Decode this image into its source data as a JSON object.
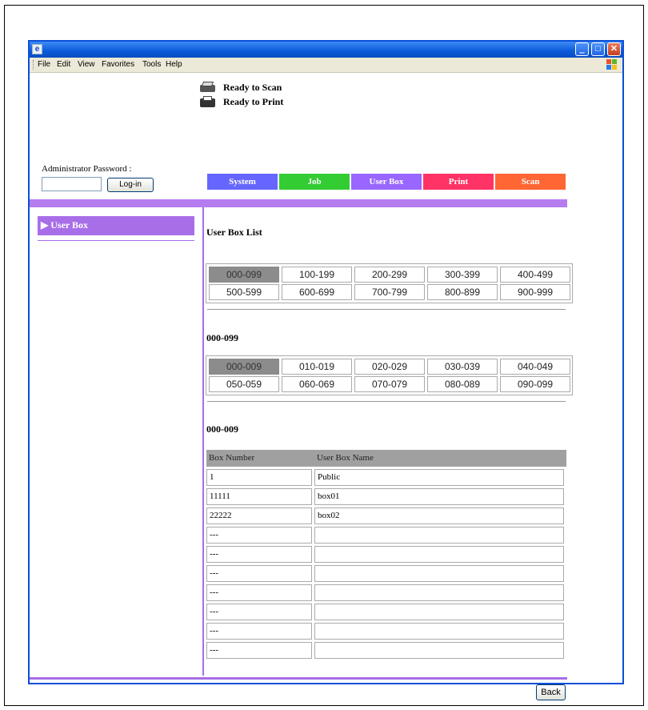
{
  "menu": [
    "File",
    "Edit",
    "View",
    "Favorites",
    "Tools",
    "Help"
  ],
  "titlebar": {
    "min": "‗",
    "max": "□",
    "close": "✕"
  },
  "status": {
    "scan": "Ready to Scan",
    "print": "Ready to Print"
  },
  "admin": {
    "label": "Administrator Password :",
    "password_value": "",
    "login_label": "Log-in"
  },
  "tabs": [
    {
      "label": "System",
      "color": "#6666ff"
    },
    {
      "label": "Job",
      "color": "#33cc33"
    },
    {
      "label": "User Box",
      "color": "#9966ff"
    },
    {
      "label": "Print",
      "color": "#ff3366"
    },
    {
      "label": "Scan",
      "color": "#ff6633"
    }
  ],
  "sidebar": {
    "item": "▶ User Box"
  },
  "list_title": "User Box List",
  "ranges": [
    [
      "000-099",
      "100-199",
      "200-299",
      "300-399",
      "400-499"
    ],
    [
      "500-599",
      "600-699",
      "700-799",
      "800-899",
      "900-999"
    ]
  ],
  "sub_title": "000-099",
  "subranges": [
    [
      "000-009",
      "010-019",
      "020-029",
      "030-039",
      "040-049"
    ],
    [
      "050-059",
      "060-069",
      "070-079",
      "080-089",
      "090-099"
    ]
  ],
  "box_title": "000-009",
  "box_table": {
    "headers": [
      "Box Number",
      "User Box Name"
    ],
    "rows": [
      [
        "1",
        "Public"
      ],
      [
        "11111",
        "box01"
      ],
      [
        "22222",
        "box02"
      ],
      [
        "---",
        ""
      ],
      [
        "---",
        ""
      ],
      [
        "---",
        ""
      ],
      [
        "---",
        ""
      ],
      [
        "---",
        ""
      ],
      [
        "---",
        ""
      ],
      [
        "---",
        ""
      ]
    ]
  },
  "back_label": "Back"
}
